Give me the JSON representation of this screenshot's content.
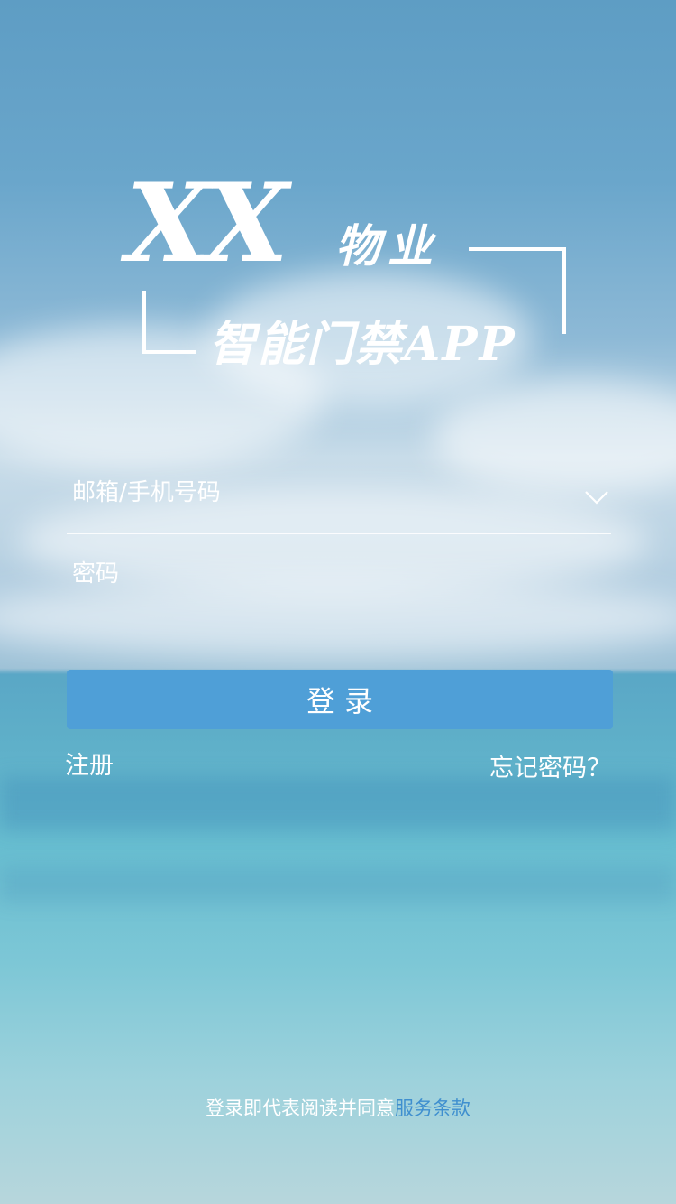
{
  "logo": {
    "brand": "XX",
    "name": "物业",
    "subtitle": "智能门禁APP"
  },
  "form": {
    "account_placeholder": "邮箱/手机号码",
    "password_placeholder": "密码",
    "account_dropdown_icon": "chevron-down-icon",
    "login_label": "登录"
  },
  "links": {
    "register": "注册",
    "forgot_password": "忘记密码？"
  },
  "terms": {
    "prefix": "登录即代表阅读并同意",
    "link": "服务条款"
  },
  "colors": {
    "primary_button": "#4f9fd7",
    "terms_link": "#3f8fcf",
    "text": "#ffffff"
  }
}
